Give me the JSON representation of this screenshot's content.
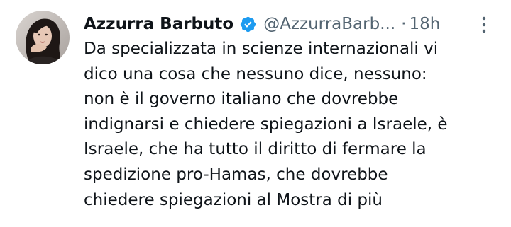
{
  "tweet": {
    "author": {
      "name": "Azzurra Barbuto",
      "handle": "@AzzurraBarb...",
      "verified_icon": "verified-badge-icon",
      "verified_color": "#1d9bf0"
    },
    "separator": "·",
    "time": "18h",
    "more_icon": "more-options-icon",
    "text_lines": [
      "Da specializzata in scienze internazionali vi",
      "dico una cosa che nessuno dice, nessuno:",
      "non è il governo italiano che dovrebbe",
      "indignarsi e chiedere spiegazioni a Israele, è",
      "Israele, che ha tutto il diritto di fermare la",
      "spedizione pro-Hamas, che dovrebbe",
      "chiedere spiegazioni al Mostra di più"
    ]
  },
  "colors": {
    "text": "#0f1419",
    "secondary": "#536471",
    "accent": "#1d9bf0"
  }
}
